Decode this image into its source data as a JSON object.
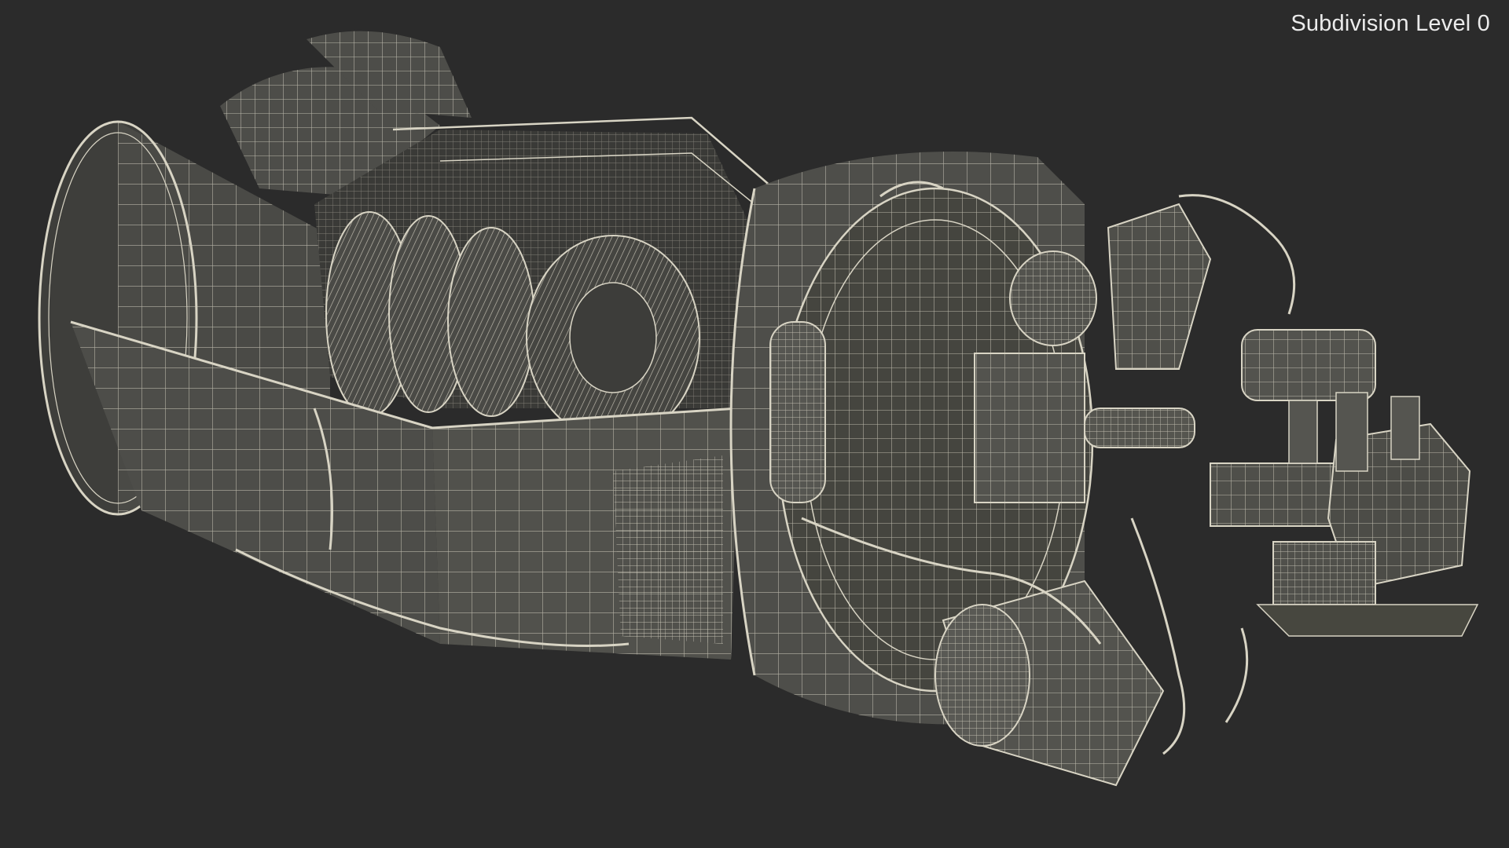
{
  "viewport": {
    "overlay_label": "Subdivision Level 0",
    "background_color": "#2b2b2b"
  },
  "model": {
    "surface_color": "#4a4a46",
    "surface_light": "#5c5c57",
    "surface_dark": "#333330",
    "wire_color": "#d8d4c4"
  }
}
